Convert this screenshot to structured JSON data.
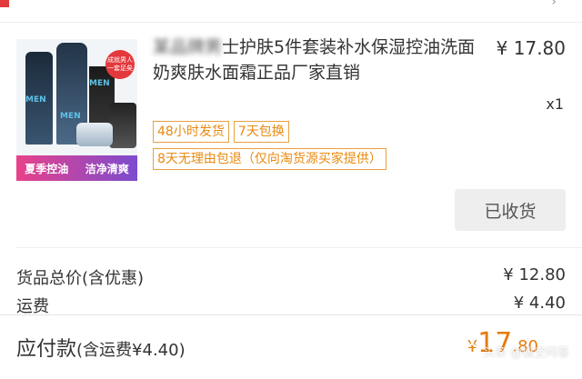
{
  "order": {
    "title_blurred": "某品牌男",
    "title_main": "士护肤5件套装补水保湿控油洗面奶爽肤水面霜正品厂家直销",
    "price": "¥ 17.80",
    "quantity": "x1",
    "tags": [
      "48小时发货",
      "7天包换",
      "8天无理由包退（仅向淘货源买家提供）"
    ],
    "received_label": "已收货",
    "thumb": {
      "badge": "成就男人一套足矣",
      "men1": "MEN",
      "men2": "MEN",
      "men3": "MEN",
      "banner_left": "夏季控油",
      "banner_right": "洁净清爽"
    }
  },
  "summary": {
    "goods_label": "货品总价(含优惠)",
    "goods_value": "¥ 12.80",
    "shipping_label": "运费",
    "shipping_value": "¥ 4.40"
  },
  "payment": {
    "label": "应付款",
    "sub": "(含运费¥4.40)",
    "currency": "¥",
    "integer": "17",
    "decimal": ".80"
  },
  "watermark": "头条 @悟空问答",
  "colors": {
    "accent": "#e87b0c",
    "tag_border": "#e8a040",
    "button_bg": "#eeeeee"
  }
}
